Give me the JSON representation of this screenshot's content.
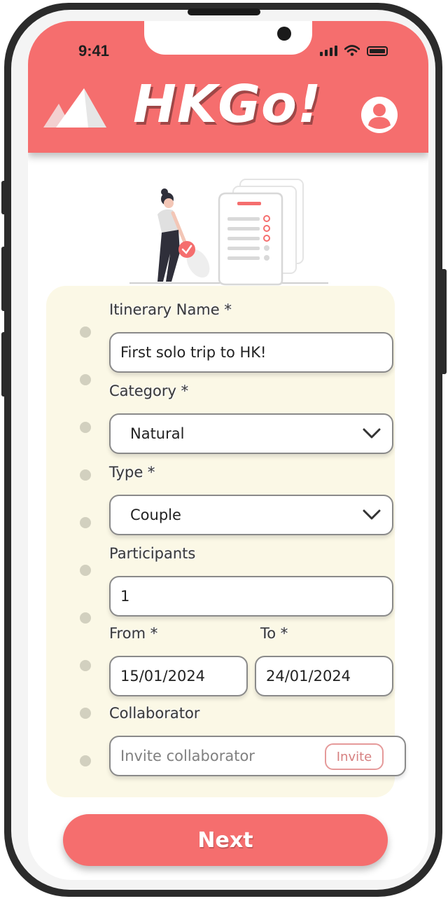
{
  "status_bar": {
    "time": "9:41"
  },
  "header": {
    "title": "HKGo!",
    "brand_color": "#f56e6e"
  },
  "form": {
    "itinerary_name": {
      "label": "Itinerary Name *",
      "value": "First solo trip to HK!"
    },
    "category": {
      "label": "Category *",
      "value": "Natural"
    },
    "type": {
      "label": "Type *",
      "value": "Couple"
    },
    "participants": {
      "label": "Participants",
      "value": "1"
    },
    "from": {
      "label": "From *",
      "value": "15/01/2024"
    },
    "to": {
      "label": "To *",
      "value": "24/01/2024"
    },
    "collaborator": {
      "label": "Collaborator",
      "placeholder": "Invite collaborator",
      "invite_label": "Invite"
    }
  },
  "next_button": {
    "label": "Next"
  },
  "icons": {
    "logo": "mountain-icon",
    "profile": "user-avatar-icon",
    "dropdown": "chevron-down-icon"
  },
  "colors": {
    "card_background": "#fbf8e6",
    "accent": "#f56e6e"
  }
}
